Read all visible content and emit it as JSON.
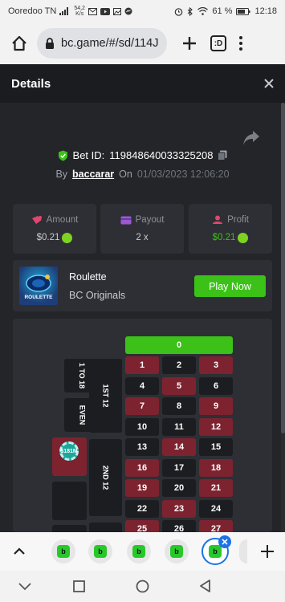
{
  "status_bar": {
    "carrier": "Ooredoo TN",
    "net_speed_value": "54,2",
    "net_speed_unit": "K/s",
    "battery": "61 %",
    "time": "12:18"
  },
  "browser": {
    "url": "bc.game/#/sd/114J",
    "tab_count": ":D"
  },
  "details": {
    "title": "Details",
    "bet_id_label": "Bet ID:",
    "bet_id": "119848640033325208",
    "by_label": "By",
    "user": "baccarar",
    "on_label": "On",
    "datetime": "01/03/2023 12:06:20"
  },
  "stats": {
    "amount_label": "Amount",
    "amount_value": "$0.21",
    "payout_label": "Payout",
    "payout_value": "2 x",
    "profit_label": "Profit",
    "profit_value": "$0.21"
  },
  "game": {
    "name": "Roulette",
    "provider": "BC Originals",
    "thumb_label": "ROULETTE",
    "play_label": "Play Now"
  },
  "board": {
    "zero": "0",
    "side_labels": [
      "1 TO 18",
      "EVEN"
    ],
    "dozen_labels": [
      "1ST 12",
      "2ND 12"
    ],
    "chip_label": "$181M",
    "rows": [
      [
        {
          "n": "1",
          "c": "red"
        },
        {
          "n": "2",
          "c": "black"
        },
        {
          "n": "3",
          "c": "red"
        }
      ],
      [
        {
          "n": "4",
          "c": "black"
        },
        {
          "n": "5",
          "c": "red"
        },
        {
          "n": "6",
          "c": "black"
        }
      ],
      [
        {
          "n": "7",
          "c": "red"
        },
        {
          "n": "8",
          "c": "black"
        },
        {
          "n": "9",
          "c": "red"
        }
      ],
      [
        {
          "n": "10",
          "c": "black"
        },
        {
          "n": "11",
          "c": "black"
        },
        {
          "n": "12",
          "c": "red"
        }
      ],
      [
        {
          "n": "13",
          "c": "black"
        },
        {
          "n": "14",
          "c": "red"
        },
        {
          "n": "15",
          "c": "black"
        }
      ],
      [
        {
          "n": "16",
          "c": "red"
        },
        {
          "n": "17",
          "c": "black"
        },
        {
          "n": "18",
          "c": "red"
        }
      ],
      [
        {
          "n": "19",
          "c": "red"
        },
        {
          "n": "20",
          "c": "black"
        },
        {
          "n": "21",
          "c": "red"
        }
      ],
      [
        {
          "n": "22",
          "c": "black"
        },
        {
          "n": "23",
          "c": "red"
        },
        {
          "n": "24",
          "c": "black"
        }
      ],
      [
        {
          "n": "25",
          "c": "red"
        },
        {
          "n": "26",
          "c": "black"
        },
        {
          "n": "27",
          "c": "red"
        }
      ]
    ]
  },
  "colors": {
    "accent_green": "#3bc117",
    "board_red": "#7d2330",
    "board_black": "#1c1d20",
    "panel": "#2d2f34"
  }
}
